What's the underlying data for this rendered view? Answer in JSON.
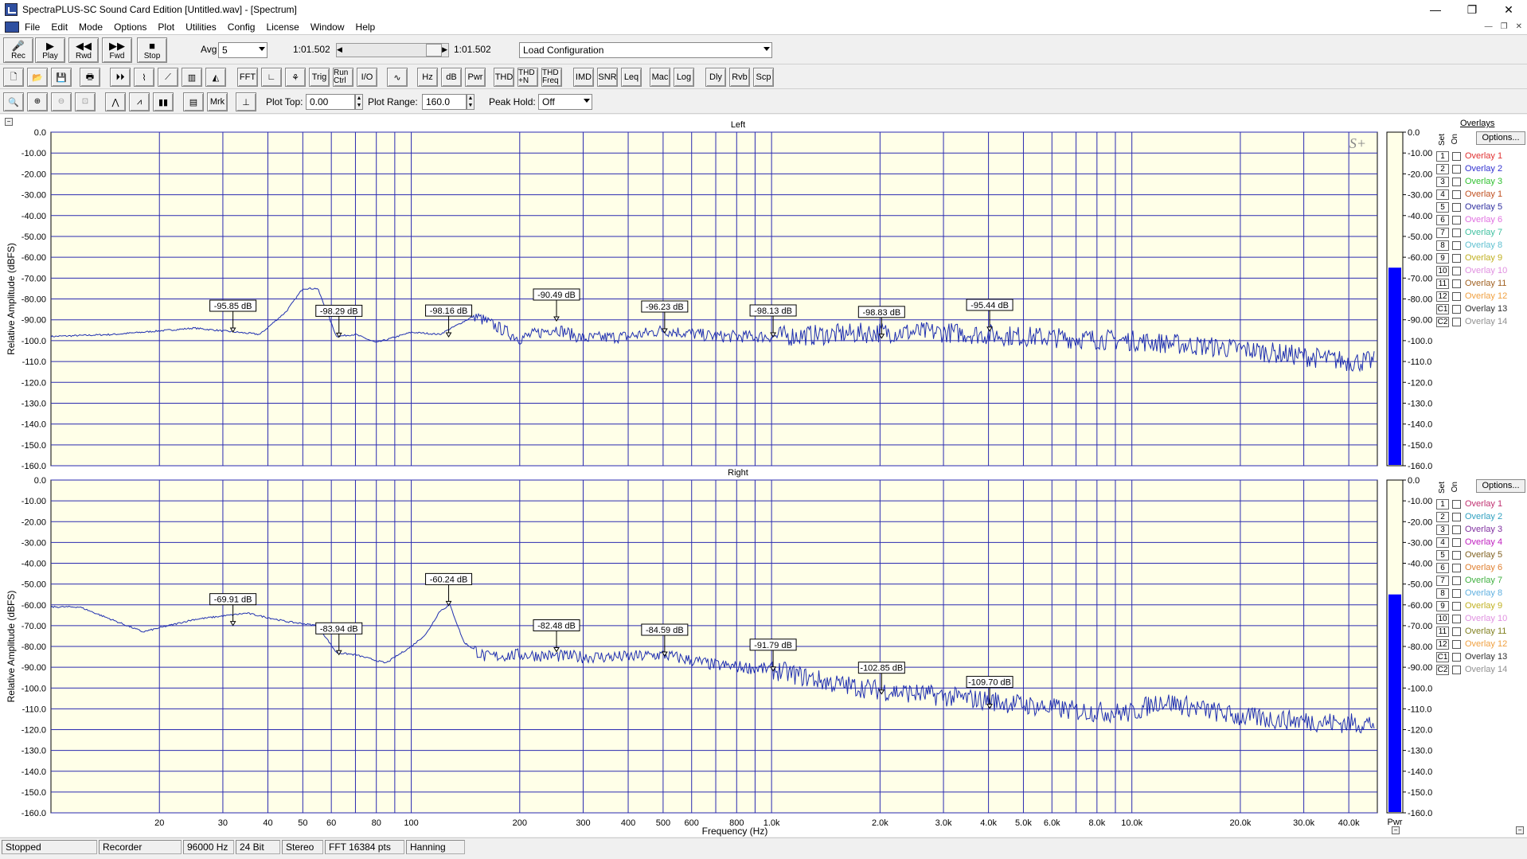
{
  "window": {
    "title": "SpectraPLUS-SC Sound Card Edition [Untitled.wav] - [Spectrum]",
    "min": "—",
    "max": "❐",
    "close": "✕"
  },
  "menu": [
    "File",
    "Edit",
    "Mode",
    "Options",
    "Plot",
    "Utilities",
    "Config",
    "License",
    "Window",
    "Help"
  ],
  "toolbar1": {
    "buttons": [
      "Rec",
      "Play",
      "Rwd",
      "Fwd",
      "Stop"
    ],
    "avg_label": "Avg",
    "avg_value": "5",
    "time_left": "1:01.502",
    "time_right": "1:01.502",
    "config_value": "Load Configuration"
  },
  "toolbar2": {
    "buttons": [
      "FFT",
      "Trig",
      "Run Ctrl",
      "I/O",
      "Hz",
      "dB",
      "Pwr",
      "THD",
      "THD +N",
      "THD Freq",
      "IMD",
      "SNR",
      "Leq",
      "Mac",
      "Log",
      "Dly",
      "Rvb",
      "Scp"
    ]
  },
  "toolbar3": {
    "buttons": [
      "Mrk"
    ],
    "plot_top_label": "Plot Top:",
    "plot_top_value": "0.00",
    "plot_range_label": "Plot Range:",
    "plot_range_value": "160.0",
    "peak_hold_label": "Peak Hold:",
    "peak_hold_value": "Off"
  },
  "colors": {
    "plot_bg": "#ffffe8",
    "grid": "#2a2ab0",
    "trace": "#1f2fb0",
    "meter": "#0000ff"
  },
  "overlays": {
    "header": "Overlays",
    "options": "Options...",
    "set_label": "Set",
    "on_label": "On",
    "pwr_label": "Pwr",
    "sets": [
      "1",
      "2",
      "3",
      "4",
      "5",
      "6",
      "7",
      "8",
      "9",
      "10",
      "11",
      "12",
      "C1",
      "C2"
    ],
    "left": [
      {
        "name": "Overlay 1",
        "color": "#e03030"
      },
      {
        "name": "Overlay 2",
        "color": "#3030d0"
      },
      {
        "name": "Overlay 3",
        "color": "#30c030"
      },
      {
        "name": "Overlay 1",
        "color": "#c05020"
      },
      {
        "name": "Overlay 5",
        "color": "#3030a0"
      },
      {
        "name": "Overlay 6",
        "color": "#e070e0"
      },
      {
        "name": "Overlay 7",
        "color": "#40c0a0"
      },
      {
        "name": "Overlay 8",
        "color": "#60c0d0"
      },
      {
        "name": "Overlay 9",
        "color": "#c0b020"
      },
      {
        "name": "Overlay 10",
        "color": "#e090e0"
      },
      {
        "name": "Overlay 11",
        "color": "#a06020"
      },
      {
        "name": "Overlay 12",
        "color": "#f0a040"
      },
      {
        "name": "Overlay 13",
        "color": "#303030"
      },
      {
        "name": "Overlay 14",
        "color": "#909090"
      }
    ],
    "right": [
      {
        "name": "Overlay 1",
        "color": "#c03070"
      },
      {
        "name": "Overlay 2",
        "color": "#30a0c0"
      },
      {
        "name": "Overlay 3",
        "color": "#8030a0"
      },
      {
        "name": "Overlay 4",
        "color": "#c020c0"
      },
      {
        "name": "Overlay 5",
        "color": "#806020"
      },
      {
        "name": "Overlay 6",
        "color": "#e08030"
      },
      {
        "name": "Overlay 7",
        "color": "#40b040"
      },
      {
        "name": "Overlay 8",
        "color": "#60b0e0"
      },
      {
        "name": "Overlay 9",
        "color": "#c0b020"
      },
      {
        "name": "Overlay 10",
        "color": "#e090e0"
      },
      {
        "name": "Overlay 11",
        "color": "#808020"
      },
      {
        "name": "Overlay 12",
        "color": "#f0a040"
      },
      {
        "name": "Overlay 13",
        "color": "#303030"
      },
      {
        "name": "Overlay 14",
        "color": "#909090"
      }
    ]
  },
  "chart_data": [
    {
      "type": "line",
      "title": "Left",
      "ylabel": "Relative Amplitude (dBFS)",
      "xlabel": "Frequency (Hz)",
      "xscale": "log",
      "xlim": [
        10,
        48000
      ],
      "ylim": [
        -160,
        0
      ],
      "yticks": [
        "0.0",
        "-10.00",
        "-20.00",
        "-30.00",
        "-40.00",
        "-50.00",
        "-60.00",
        "-70.00",
        "-80.00",
        "-90.00",
        "-100.0",
        "-110.0",
        "-120.0",
        "-130.0",
        "-140.0",
        "-150.0",
        "-160.0"
      ],
      "meter_yticks": [
        "0.0",
        "-10.00",
        "-20.00",
        "-30.00",
        "-40.00",
        "-50.00",
        "-60.00",
        "-70.00",
        "-80.00",
        "-90.00",
        "-100.0",
        "-110.0",
        "-120.0",
        "-130.0",
        "-140.0",
        "-150.0",
        "-160.0"
      ],
      "meter_level": -65,
      "series": [
        {
          "x": [
            10,
            15,
            25,
            38,
            45,
            50,
            55,
            62,
            70,
            80,
            100,
            120,
            150,
            200,
            250,
            300,
            400,
            500,
            700,
            1000,
            1500,
            2000,
            3000,
            5000,
            10000,
            20000,
            40000
          ],
          "y": [
            -98,
            -97,
            -94,
            -97,
            -86,
            -75,
            -75,
            -98,
            -97,
            -101,
            -96,
            -97,
            -88,
            -99,
            -94,
            -99,
            -98,
            -95,
            -98,
            -98,
            -97,
            -96,
            -96,
            -98,
            -100,
            -104,
            -110
          ]
        }
      ],
      "markers": [
        {
          "x": 32,
          "y": -95.85,
          "label": "-95.85 dB"
        },
        {
          "x": 63,
          "y": -98.29,
          "label": "-98.29 dB"
        },
        {
          "x": 127,
          "y": -98.16,
          "label": "-98.16 dB"
        },
        {
          "x": 253,
          "y": -90.49,
          "label": "-90.49 dB"
        },
        {
          "x": 505,
          "y": -96.23,
          "label": "-96.23 dB"
        },
        {
          "x": 1010,
          "y": -98.13,
          "label": "-98.13 dB"
        },
        {
          "x": 2020,
          "y": -98.83,
          "label": "-98.83 dB"
        },
        {
          "x": 4030,
          "y": -95.44,
          "label": "-95.44 dB"
        }
      ],
      "logo": "S+"
    },
    {
      "type": "line",
      "title": "Right",
      "ylabel": "Relative Amplitude (dBFS)",
      "xlabel": "Frequency (Hz)",
      "xscale": "log",
      "xlim": [
        10,
        48000
      ],
      "ylim": [
        -160,
        0
      ],
      "yticks": [
        "0.0",
        "-10.00",
        "-20.00",
        "-30.00",
        "-40.00",
        "-50.00",
        "-60.00",
        "-70.00",
        "-80.00",
        "-90.00",
        "-100.0",
        "-110.0",
        "-120.0",
        "-130.0",
        "-140.0",
        "-150.0",
        "-160.0"
      ],
      "meter_yticks": [
        "0.0",
        "-10.00",
        "-20.00",
        "-30.00",
        "-40.00",
        "-50.00",
        "-60.00",
        "-70.00",
        "-80.00",
        "-90.00",
        "-100.0",
        "-110.0",
        "-120.0",
        "-130.0",
        "-140.0",
        "-150.0",
        "-160.0"
      ],
      "meter_level": -55,
      "xticks": [
        {
          "v": 20,
          "t": "20"
        },
        {
          "v": 30,
          "t": "30"
        },
        {
          "v": 40,
          "t": "40"
        },
        {
          "v": 50,
          "t": "50"
        },
        {
          "v": 60,
          "t": "60"
        },
        {
          "v": 80,
          "t": "80"
        },
        {
          "v": 100,
          "t": "100"
        },
        {
          "v": 200,
          "t": "200"
        },
        {
          "v": 300,
          "t": "300"
        },
        {
          "v": 400,
          "t": "400"
        },
        {
          "v": 500,
          "t": "500"
        },
        {
          "v": 600,
          "t": "600"
        },
        {
          "v": 800,
          "t": "800"
        },
        {
          "v": 1000,
          "t": "1.0k"
        },
        {
          "v": 2000,
          "t": "2.0k"
        },
        {
          "v": 3000,
          "t": "3.0k"
        },
        {
          "v": 4000,
          "t": "4.0k"
        },
        {
          "v": 5000,
          "t": "5.0k"
        },
        {
          "v": 6000,
          "t": "6.0k"
        },
        {
          "v": 8000,
          "t": "8.0k"
        },
        {
          "v": 10000,
          "t": "10.0k"
        },
        {
          "v": 20000,
          "t": "20.0k"
        },
        {
          "v": 30000,
          "t": "30.0k"
        },
        {
          "v": 40000,
          "t": "40.0k"
        }
      ],
      "series": [
        {
          "x": [
            10,
            12,
            18,
            25,
            35,
            45,
            55,
            62,
            70,
            85,
            100,
            110,
            120,
            128,
            140,
            160,
            200,
            300,
            400,
            500,
            700,
            1000,
            1500,
            2000,
            3000,
            4000,
            5000,
            7000,
            10000,
            12000,
            20000,
            40000
          ],
          "y": [
            -61,
            -61,
            -73,
            -67,
            -64,
            -68,
            -70,
            -83,
            -84,
            -88,
            -80,
            -74,
            -63,
            -60,
            -78,
            -85,
            -84,
            -85,
            -85,
            -84,
            -89,
            -91,
            -98,
            -101,
            -104,
            -106,
            -108,
            -111,
            -112,
            -106,
            -114,
            -117
          ]
        }
      ],
      "markers": [
        {
          "x": 32,
          "y": -69.91,
          "label": "-69.91 dB"
        },
        {
          "x": 63,
          "y": -83.94,
          "label": "-83.94 dB"
        },
        {
          "x": 127,
          "y": -60.24,
          "label": "-60.24 dB"
        },
        {
          "x": 253,
          "y": -82.48,
          "label": "-82.48 dB"
        },
        {
          "x": 505,
          "y": -84.59,
          "label": "-84.59 dB"
        },
        {
          "x": 1010,
          "y": -91.79,
          "label": "-91.79 dB"
        },
        {
          "x": 2020,
          "y": -102.85,
          "label": "-102.85 dB"
        },
        {
          "x": 4030,
          "y": -109.7,
          "label": "-109.70 dB"
        }
      ]
    }
  ],
  "status": {
    "state": "Stopped",
    "mode": "Recorder",
    "rate": "96000 Hz",
    "bits": "24 Bit",
    "channels": "Stereo",
    "fft": "FFT 16384 pts",
    "window": "Hanning"
  }
}
